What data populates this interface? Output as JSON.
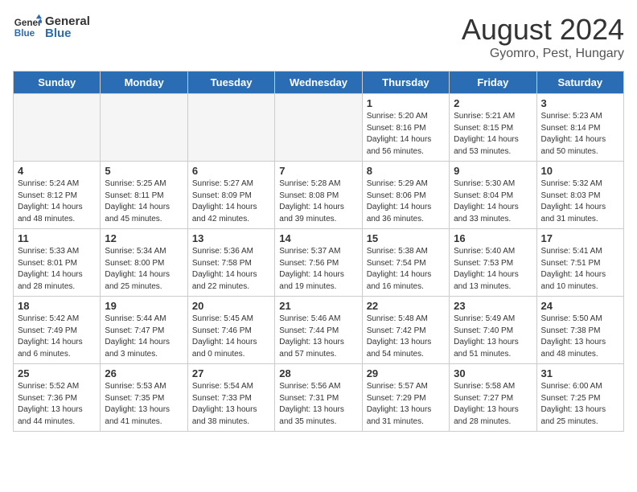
{
  "header": {
    "logo_line1": "General",
    "logo_line2": "Blue",
    "main_title": "August 2024",
    "subtitle": "Gyomro, Pest, Hungary"
  },
  "days_of_week": [
    "Sunday",
    "Monday",
    "Tuesday",
    "Wednesday",
    "Thursday",
    "Friday",
    "Saturday"
  ],
  "weeks": [
    [
      {
        "day": "",
        "info": ""
      },
      {
        "day": "",
        "info": ""
      },
      {
        "day": "",
        "info": ""
      },
      {
        "day": "",
        "info": ""
      },
      {
        "day": "1",
        "info": "Sunrise: 5:20 AM\nSunset: 8:16 PM\nDaylight: 14 hours\nand 56 minutes."
      },
      {
        "day": "2",
        "info": "Sunrise: 5:21 AM\nSunset: 8:15 PM\nDaylight: 14 hours\nand 53 minutes."
      },
      {
        "day": "3",
        "info": "Sunrise: 5:23 AM\nSunset: 8:14 PM\nDaylight: 14 hours\nand 50 minutes."
      }
    ],
    [
      {
        "day": "4",
        "info": "Sunrise: 5:24 AM\nSunset: 8:12 PM\nDaylight: 14 hours\nand 48 minutes."
      },
      {
        "day": "5",
        "info": "Sunrise: 5:25 AM\nSunset: 8:11 PM\nDaylight: 14 hours\nand 45 minutes."
      },
      {
        "day": "6",
        "info": "Sunrise: 5:27 AM\nSunset: 8:09 PM\nDaylight: 14 hours\nand 42 minutes."
      },
      {
        "day": "7",
        "info": "Sunrise: 5:28 AM\nSunset: 8:08 PM\nDaylight: 14 hours\nand 39 minutes."
      },
      {
        "day": "8",
        "info": "Sunrise: 5:29 AM\nSunset: 8:06 PM\nDaylight: 14 hours\nand 36 minutes."
      },
      {
        "day": "9",
        "info": "Sunrise: 5:30 AM\nSunset: 8:04 PM\nDaylight: 14 hours\nand 33 minutes."
      },
      {
        "day": "10",
        "info": "Sunrise: 5:32 AM\nSunset: 8:03 PM\nDaylight: 14 hours\nand 31 minutes."
      }
    ],
    [
      {
        "day": "11",
        "info": "Sunrise: 5:33 AM\nSunset: 8:01 PM\nDaylight: 14 hours\nand 28 minutes."
      },
      {
        "day": "12",
        "info": "Sunrise: 5:34 AM\nSunset: 8:00 PM\nDaylight: 14 hours\nand 25 minutes."
      },
      {
        "day": "13",
        "info": "Sunrise: 5:36 AM\nSunset: 7:58 PM\nDaylight: 14 hours\nand 22 minutes."
      },
      {
        "day": "14",
        "info": "Sunrise: 5:37 AM\nSunset: 7:56 PM\nDaylight: 14 hours\nand 19 minutes."
      },
      {
        "day": "15",
        "info": "Sunrise: 5:38 AM\nSunset: 7:54 PM\nDaylight: 14 hours\nand 16 minutes."
      },
      {
        "day": "16",
        "info": "Sunrise: 5:40 AM\nSunset: 7:53 PM\nDaylight: 14 hours\nand 13 minutes."
      },
      {
        "day": "17",
        "info": "Sunrise: 5:41 AM\nSunset: 7:51 PM\nDaylight: 14 hours\nand 10 minutes."
      }
    ],
    [
      {
        "day": "18",
        "info": "Sunrise: 5:42 AM\nSunset: 7:49 PM\nDaylight: 14 hours\nand 6 minutes."
      },
      {
        "day": "19",
        "info": "Sunrise: 5:44 AM\nSunset: 7:47 PM\nDaylight: 14 hours\nand 3 minutes."
      },
      {
        "day": "20",
        "info": "Sunrise: 5:45 AM\nSunset: 7:46 PM\nDaylight: 14 hours\nand 0 minutes."
      },
      {
        "day": "21",
        "info": "Sunrise: 5:46 AM\nSunset: 7:44 PM\nDaylight: 13 hours\nand 57 minutes."
      },
      {
        "day": "22",
        "info": "Sunrise: 5:48 AM\nSunset: 7:42 PM\nDaylight: 13 hours\nand 54 minutes."
      },
      {
        "day": "23",
        "info": "Sunrise: 5:49 AM\nSunset: 7:40 PM\nDaylight: 13 hours\nand 51 minutes."
      },
      {
        "day": "24",
        "info": "Sunrise: 5:50 AM\nSunset: 7:38 PM\nDaylight: 13 hours\nand 48 minutes."
      }
    ],
    [
      {
        "day": "25",
        "info": "Sunrise: 5:52 AM\nSunset: 7:36 PM\nDaylight: 13 hours\nand 44 minutes."
      },
      {
        "day": "26",
        "info": "Sunrise: 5:53 AM\nSunset: 7:35 PM\nDaylight: 13 hours\nand 41 minutes."
      },
      {
        "day": "27",
        "info": "Sunrise: 5:54 AM\nSunset: 7:33 PM\nDaylight: 13 hours\nand 38 minutes."
      },
      {
        "day": "28",
        "info": "Sunrise: 5:56 AM\nSunset: 7:31 PM\nDaylight: 13 hours\nand 35 minutes."
      },
      {
        "day": "29",
        "info": "Sunrise: 5:57 AM\nSunset: 7:29 PM\nDaylight: 13 hours\nand 31 minutes."
      },
      {
        "day": "30",
        "info": "Sunrise: 5:58 AM\nSunset: 7:27 PM\nDaylight: 13 hours\nand 28 minutes."
      },
      {
        "day": "31",
        "info": "Sunrise: 6:00 AM\nSunset: 7:25 PM\nDaylight: 13 hours\nand 25 minutes."
      }
    ]
  ]
}
